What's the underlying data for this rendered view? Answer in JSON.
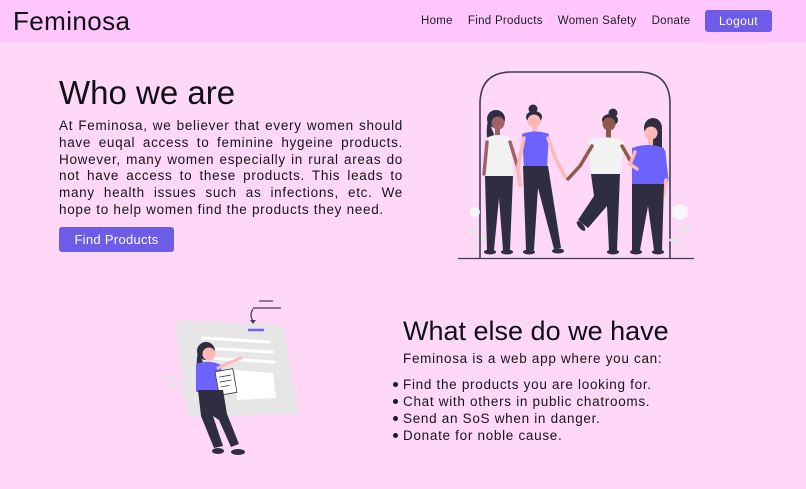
{
  "navbar": {
    "brand": "Feminosa",
    "links": [
      {
        "label": "Home"
      },
      {
        "label": "Find Products"
      },
      {
        "label": "Women Safety"
      },
      {
        "label": "Donate"
      }
    ],
    "logout_label": "Logout"
  },
  "about": {
    "heading": "Who we are",
    "body": "At Feminosa, we believer that every women should have euqal access to feminine hygeine products. However, many women especially in rural areas do not have access to these products. This leads to many health issues such as infections, etc. We hope to help women find the products they need.",
    "cta_label": "Find Products",
    "illustration_icon": "group-of-women-illustration"
  },
  "features": {
    "heading": "What else do we have",
    "intro": "Feminosa is a web app where you can:",
    "items": [
      "Find the products you are looking for.",
      "Chat with others in public chatrooms.",
      "Send an SoS when in danger.",
      "Donate for noble cause."
    ],
    "illustration_icon": "woman-with-document-illustration"
  },
  "colors": {
    "page_background": "#ffd7f7",
    "navbar_background": "#ffc6fb",
    "accent": "#6c5ce7",
    "text": "#17171f",
    "illustration_purple": "#6c63ff",
    "illustration_dark": "#2f2e41"
  }
}
